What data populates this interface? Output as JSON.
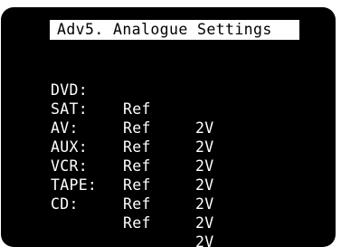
{
  "title": "Adv5. Analogue Settings",
  "rows": [
    {
      "source": "DVD:",
      "mode": "Ref",
      "level": "2V"
    },
    {
      "source": "SAT:",
      "mode": "Ref",
      "level": "2V"
    },
    {
      "source": "AV:",
      "mode": "Ref",
      "level": "2V"
    },
    {
      "source": "AUX:",
      "mode": "Ref",
      "level": "2V"
    },
    {
      "source": "VCR:",
      "mode": "Ref",
      "level": "2V"
    },
    {
      "source": "TAPE:",
      "mode": "Ref",
      "level": "2V"
    },
    {
      "source": "CD:",
      "mode": "Ref",
      "level": "2V"
    }
  ],
  "colors": {
    "screen_background": "#000000",
    "text": "#ffffff",
    "title_background": "#ffffff",
    "title_text": "#000000"
  }
}
